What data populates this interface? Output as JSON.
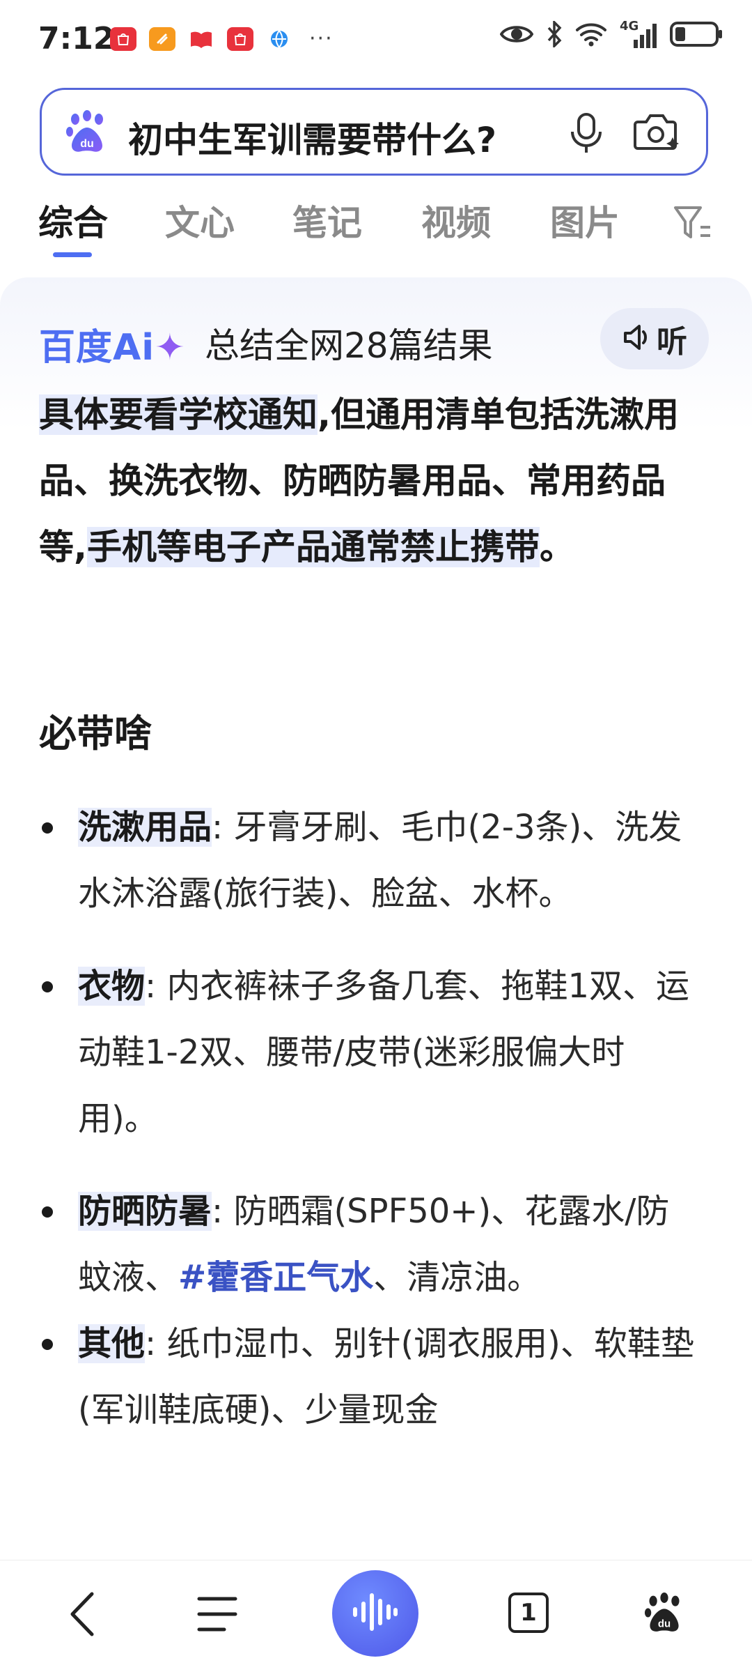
{
  "status_bar": {
    "time": "7:12",
    "more": "···",
    "network": "4G",
    "notification_icons": [
      "huawei-store-icon",
      "orange-app-icon",
      "red-book-icon",
      "huawei-store-icon",
      "blue-globe-icon"
    ]
  },
  "search": {
    "query": "初中生军训需要带什么?"
  },
  "tabs": [
    {
      "label": "综合",
      "active": true
    },
    {
      "label": "文心"
    },
    {
      "label": "笔记"
    },
    {
      "label": "视频"
    },
    {
      "label": "图片"
    }
  ],
  "ai_card": {
    "logo_text": "百度Ai",
    "logo_star": "✦",
    "summary": "总结全网28篇结果",
    "listen_label": "听",
    "answer_hl1": "具体要看学校通知",
    "answer_mid": ",但通用清单包括洗漱用品、换洗衣物、防晒防暑用品、常用药品等,",
    "answer_hl2": "手机等电子产品通常禁止携带",
    "answer_end": "。",
    "section_title": "必带啥",
    "bullets": [
      {
        "key": "洗漱用品",
        "text": ":  牙膏牙刷、毛巾(2-3条)、洗发水沐浴露(旅行装)、脸盆、水杯。"
      },
      {
        "key": "衣物",
        "text": ":  内衣裤袜子多备几套、拖鞋1双、运动鞋1-2双、腰带/皮带(迷彩服偏大时用)。"
      },
      {
        "key": "防晒防暑",
        "text": ":  防晒霜(SPF50+)、花露水/防蚊液、",
        "tag": "#藿香正气水",
        "text_after": "、清凉油。"
      },
      {
        "key": "其他",
        "text": ":  纸巾湿巾、别针(调衣服用)、软鞋垫(军训鞋底硬)、少量现金"
      }
    ]
  },
  "bottom_nav": {
    "tab_count": "1"
  },
  "colors": {
    "accent": "#4e6ef2",
    "highlight": "#e6ebfc",
    "tag": "#3a52c4"
  }
}
